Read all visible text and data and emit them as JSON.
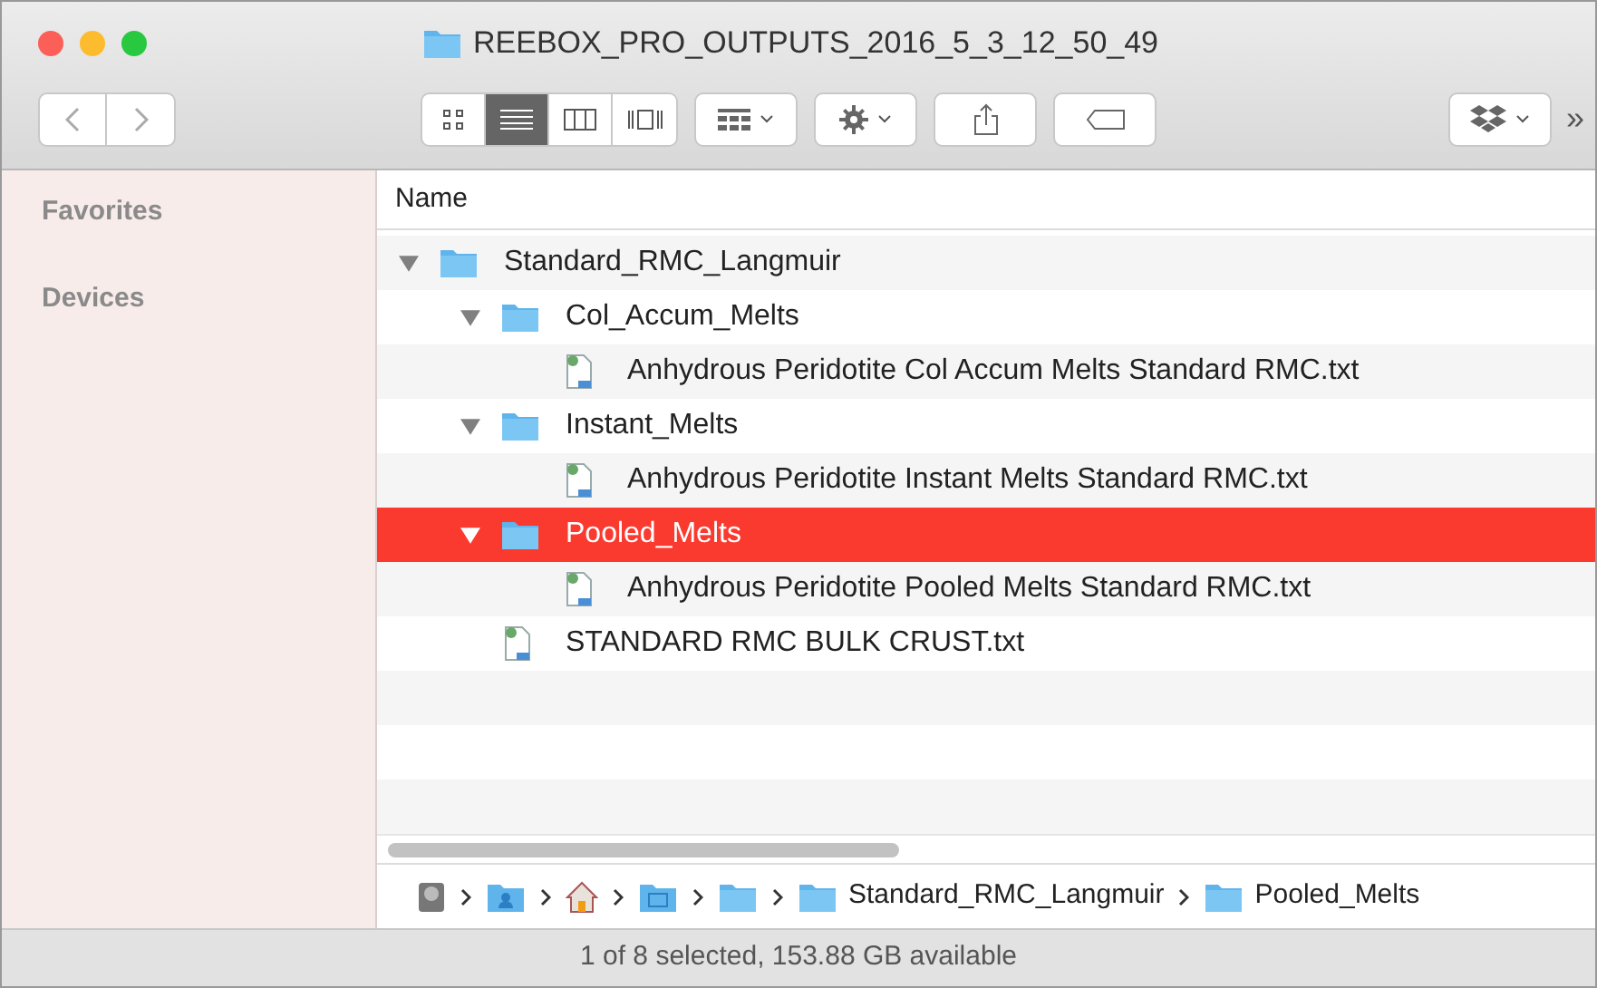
{
  "window": {
    "title": "REEBOX_PRO_OUTPUTS_2016_5_3_12_50_49"
  },
  "view_modes": [
    {
      "kind": "icons",
      "selected": false
    },
    {
      "kind": "list",
      "selected": true
    },
    {
      "kind": "columns",
      "selected": false
    },
    {
      "kind": "coverflow",
      "selected": false
    }
  ],
  "overflow": "»",
  "sidebar": {
    "sections": [
      "Favorites",
      "Devices"
    ]
  },
  "table": {
    "columns": [
      "Name"
    ],
    "rows": [
      {
        "kind": "folder",
        "name": "Standard_RMC_Langmuir",
        "expanded": true,
        "selected": false,
        "children": [
          {
            "kind": "folder",
            "name": "Col_Accum_Melts",
            "expanded": true,
            "selected": false,
            "children": [
              {
                "kind": "file",
                "name": "Anhydrous Peridotite Col Accum Melts Standard RMC.txt",
                "selected": false
              }
            ]
          },
          {
            "kind": "folder",
            "name": "Instant_Melts",
            "expanded": true,
            "selected": false,
            "children": [
              {
                "kind": "file",
                "name": "Anhydrous Peridotite Instant Melts Standard RMC.txt",
                "selected": false
              }
            ]
          },
          {
            "kind": "folder",
            "name": "Pooled_Melts",
            "expanded": true,
            "selected": true,
            "children": [
              {
                "kind": "file",
                "name": "Anhydrous Peridotite Pooled Melts Standard RMC.txt",
                "selected": false
              }
            ]
          },
          {
            "kind": "file",
            "name": "STANDARD RMC BULK CRUST.txt",
            "selected": false
          }
        ]
      }
    ]
  },
  "path_bar": [
    {
      "kind": "disk"
    },
    {
      "kind": "user"
    },
    {
      "kind": "home"
    },
    {
      "kind": "window"
    },
    {
      "kind": "folder"
    },
    {
      "kind": "folder",
      "name": "Standard_RMC_Langmuir"
    },
    {
      "kind": "folder",
      "name": "Pooled_Melts"
    }
  ],
  "status_bar": "1 of 8 selected, 153.88 GB available"
}
